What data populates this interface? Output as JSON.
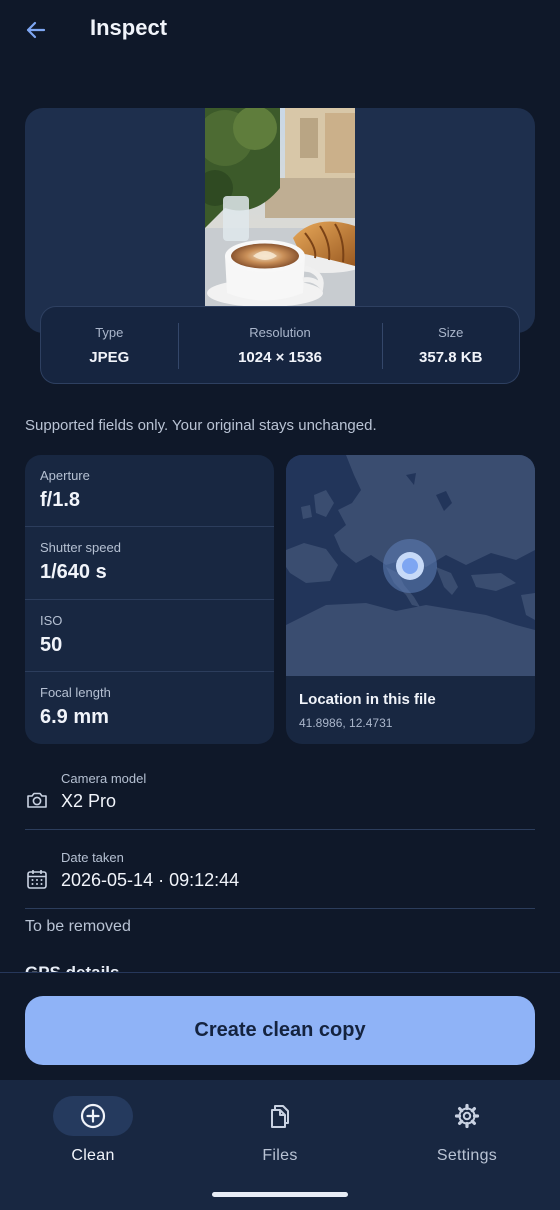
{
  "header": {
    "title": "Inspect",
    "back_icon": "arrow-left-icon"
  },
  "file_info": [
    {
      "label": "Type",
      "value": "JPEG"
    },
    {
      "label": "Resolution",
      "value": "1024 × 1536"
    },
    {
      "label": "Size",
      "value": "357.8 KB"
    }
  ],
  "note": "Supported fields only. Your original stays unchanged.",
  "exif": [
    {
      "label": "Aperture",
      "value": "f/1.8"
    },
    {
      "label": "Shutter speed",
      "value": "1/640 s"
    },
    {
      "label": "ISO",
      "value": "50"
    },
    {
      "label": "Focal length",
      "value": "6.9 mm"
    }
  ],
  "map": {
    "title": "Location in this file",
    "coords": "41.8986, 12.4731"
  },
  "details": [
    {
      "icon": "camera-icon",
      "label": "Camera model",
      "value": "X2 Pro"
    },
    {
      "icon": "calendar-icon",
      "label": "Date taken",
      "value": "2026-05-14 · 09:12:44"
    }
  ],
  "removal": {
    "section_label": "To be removed",
    "gps_heading": "GPS details"
  },
  "cta": {
    "label": "Create clean copy"
  },
  "nav": [
    {
      "icon": "add-circle-icon",
      "label": "Clean",
      "active": true
    },
    {
      "icon": "files-icon",
      "label": "Files",
      "active": false
    },
    {
      "icon": "gear-icon",
      "label": "Settings",
      "active": false
    }
  ],
  "colors": {
    "background": "#0f1829",
    "card": "#182741",
    "accent": "#8fb3f7",
    "back_arrow": "#7ea6f2"
  }
}
